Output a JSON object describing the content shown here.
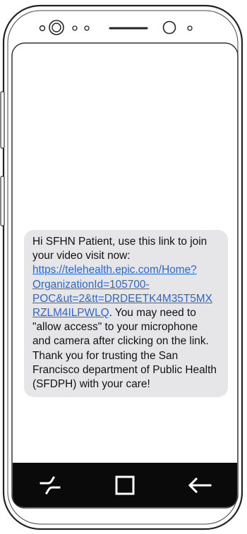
{
  "message": {
    "text_before": "Hi SFHN Patient, use this link to join your video visit now: ",
    "link": "https://telehealth.epic.com/Home?OrganizationId=105700-POC&ut=2&tt=DRDEETK4M35T5MXRZLM4ILPWLQ",
    "text_after": ". You may need to \"allow access\" to your microphone and camera after clicking on the link.  Thank you for trusting the San Francisco department of Public Health (SFDPH) with your care!"
  },
  "nav": {
    "recents_icon": "recent-apps-icon",
    "home_icon": "home-icon",
    "back_icon": "back-arrow-icon"
  }
}
